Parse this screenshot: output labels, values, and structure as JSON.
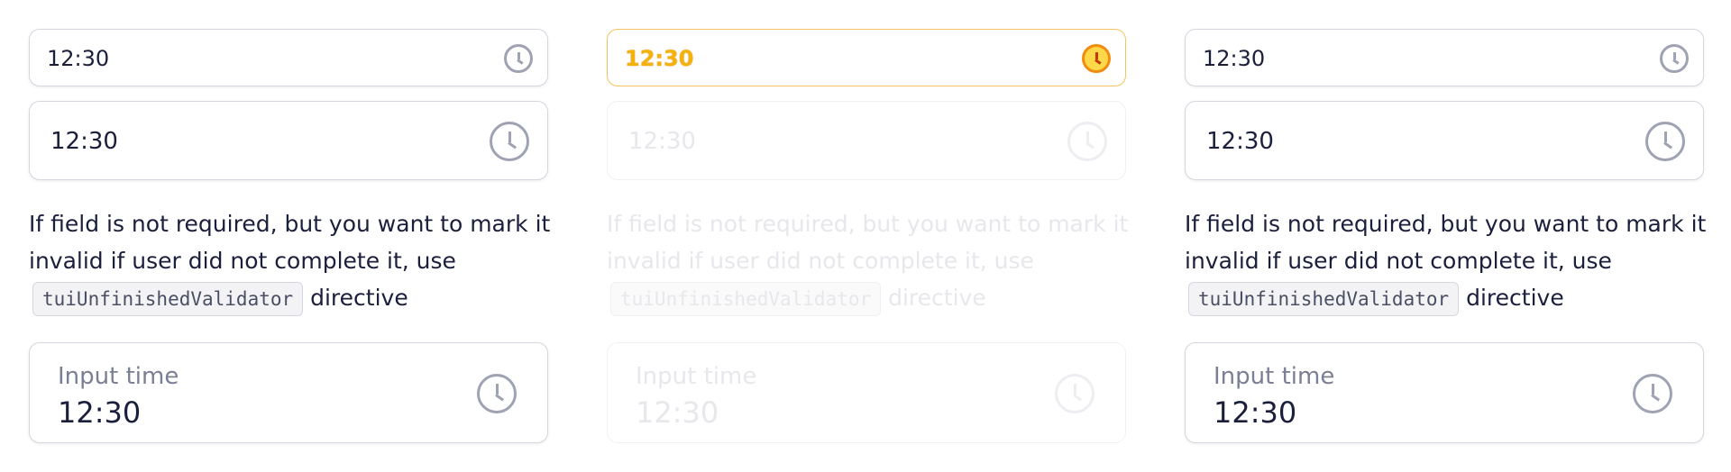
{
  "columns": [
    {
      "time_small": "12:30",
      "time_medium": "12:30",
      "paragraph_text": "If field is not required, but you want to mark it invalid if user did not complete it, use",
      "code": "tuiUnfinishedValidator",
      "suffix": "directive",
      "input_label": "Input time",
      "input_value": "12:30"
    },
    {
      "time_small": "12:30",
      "time_medium": "12:30",
      "paragraph_text": "If field is not required, but you want to mark it invalid if user did not complete it, use",
      "code": "tuiUnfinishedValidator",
      "suffix": "directive",
      "input_label": "Input time",
      "input_value": "12:30"
    },
    {
      "time_small": "12:30",
      "time_medium": "12:30",
      "paragraph_text": "If field is not required, but you want to mark it invalid if user did not complete it, use",
      "code": "tuiUnfinishedValidator",
      "suffix": "directive",
      "input_label": "Input time",
      "input_value": "12:30"
    }
  ],
  "icons": [
    "clock-icon"
  ]
}
